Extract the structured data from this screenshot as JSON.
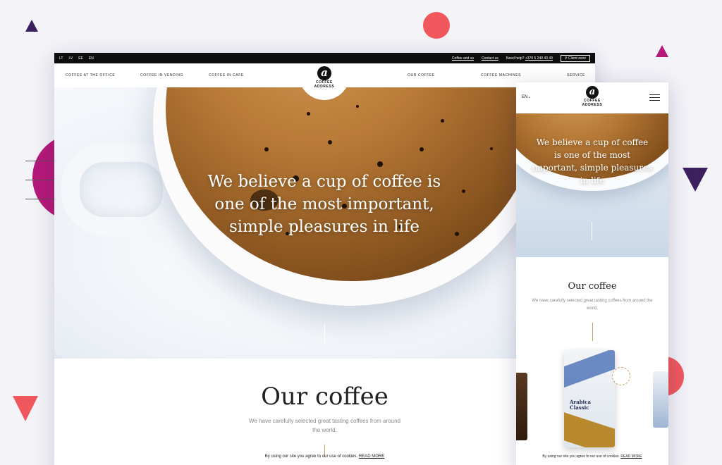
{
  "desktop": {
    "topbar": {
      "langs": [
        "LT",
        "LV",
        "EE",
        "EN"
      ],
      "coffee_and_us": "Coffee and us",
      "contact_us": "Contact us",
      "need_help": "Need help?",
      "phone": "+370 5 240 43 43",
      "client_zone": "Client zone"
    },
    "nav": {
      "office": "COFFEE AT THE OFFICE",
      "vending": "COFFEE IN VENDING",
      "cafe": "COFFEE IN CAFE",
      "our_coffee": "OUR COFFEE",
      "machines": "COFFEE MACHINES",
      "service": "SERVICE"
    },
    "logo": {
      "mark": "a",
      "line1": "COFFEE",
      "line2": "ADDRESS"
    },
    "hero_text": "We believe a cup of coffee is one of the most important, simple pleasures in life",
    "section_title": "Our coffee",
    "section_text": "We have carefully selected great tasting coffees from around the world.",
    "cookie_text": "By using our site you agree to our use of cookies.",
    "cookie_link": "READ MORE"
  },
  "mobile": {
    "lang": "EN",
    "logo": {
      "mark": "a",
      "line1": "COFFEE",
      "line2": "ADDRESS"
    },
    "hero_text": "We believe a cup of coffee is one of the most important, simple pleasures in life",
    "section_title": "Our coffee",
    "section_text": "We have carefully selected great tasting coffees from around the world.",
    "bag_label_1": "Arabica",
    "bag_label_2": "Classic",
    "cookie_text": "By using our site you agree to our use of cookies.",
    "cookie_link": "READ MORE"
  },
  "colors": {
    "navy": "#3b1f5f",
    "magenta": "#b5197a",
    "coral": "#f0585e",
    "gold": "#c8a25c"
  }
}
